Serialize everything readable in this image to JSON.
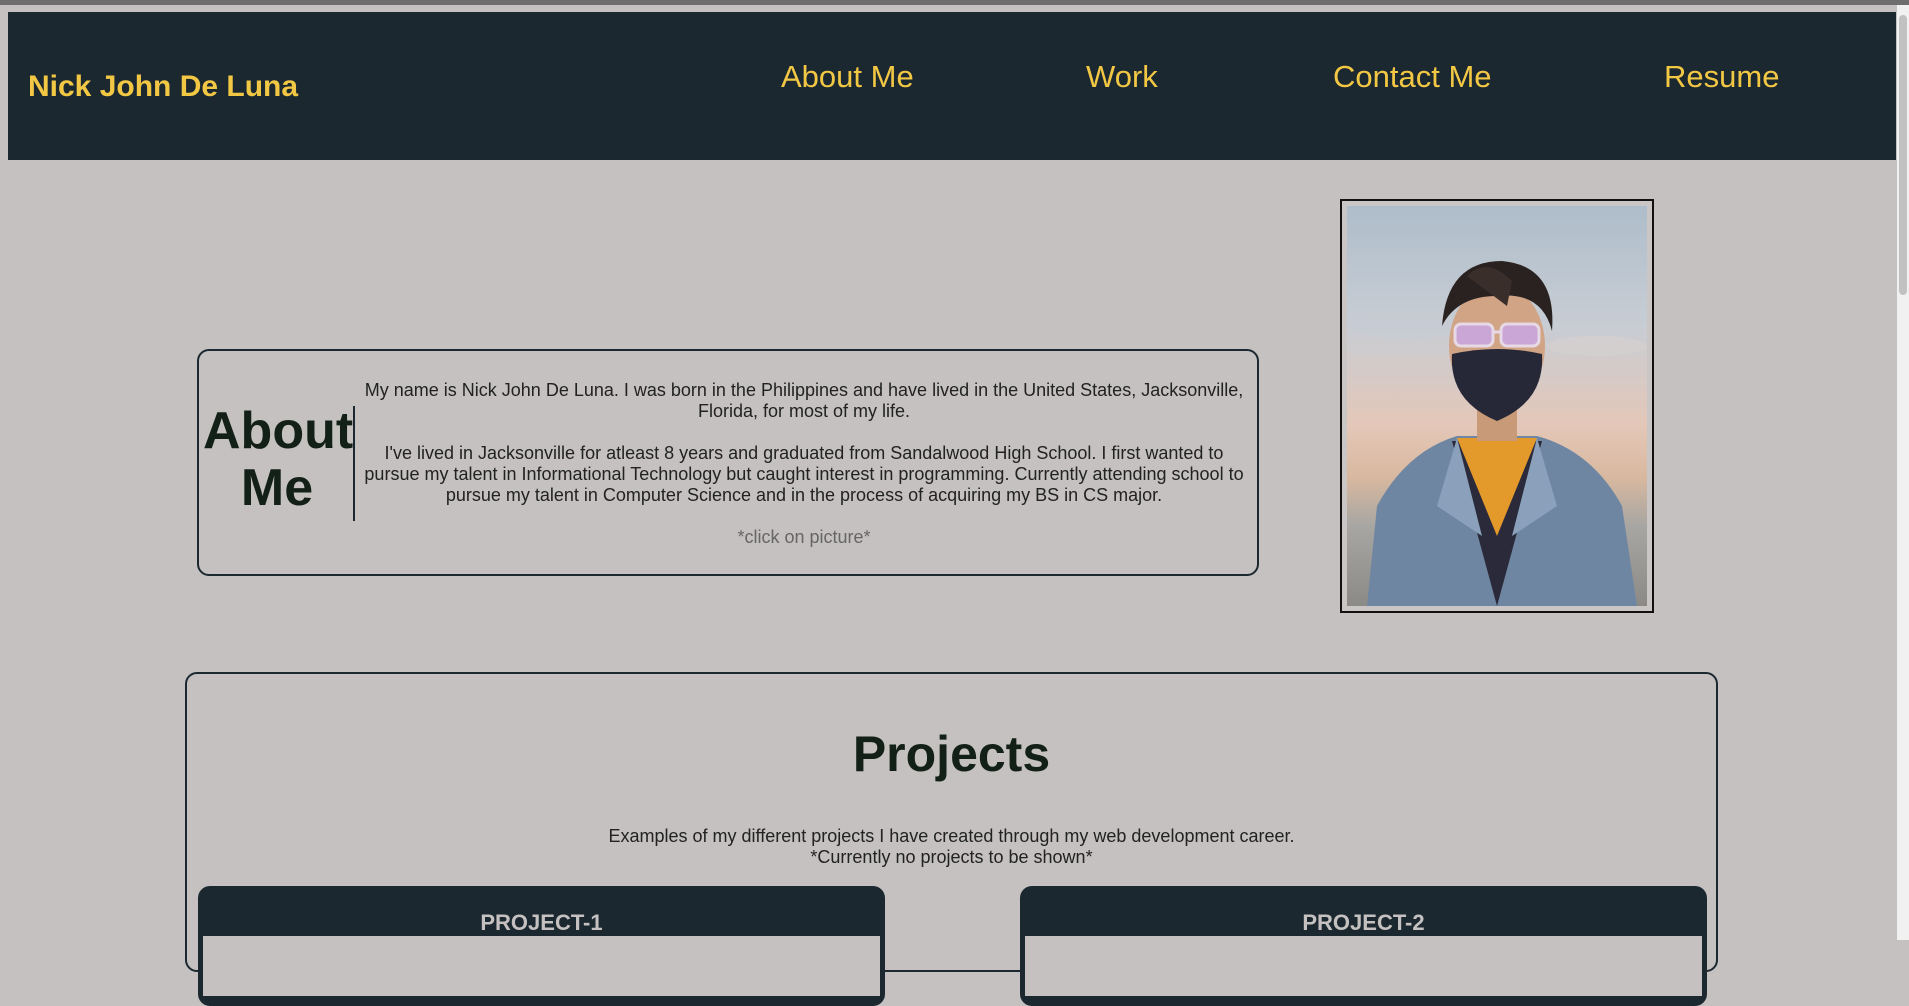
{
  "header": {
    "brand": "Nick John De Luna",
    "nav": [
      {
        "label": "About Me"
      },
      {
        "label": "Work"
      },
      {
        "label": "Contact Me"
      },
      {
        "label": "Resume"
      }
    ]
  },
  "about": {
    "title_line1": "About",
    "title_line2": "Me",
    "paragraph1": "My name is Nick John De Luna. I was born in the Philippines and have lived in the United States, Jacksonville, Florida, for most of my life.",
    "paragraph2": "I've lived in Jacksonville for atleast 8 years and graduated from Sandalwood High School. I first wanted to pursue my talent in Informational Technology but caught interest in programming. Currently attending school to pursue my talent in Computer Science and in the process of acquiring my BS in CS major.",
    "click_note": "*click on picture*"
  },
  "projects": {
    "title": "Projects",
    "desc_line1": "Examples of my different projects I have created through my web development career.",
    "desc_line2": "*Currently no projects to be shown*",
    "cards": [
      {
        "label": "PROJECT-1"
      },
      {
        "label": "PROJECT-2"
      }
    ]
  },
  "colors": {
    "accent": "#f2c744",
    "header_bg": "#1c2830",
    "page_bg": "#c4c1c0"
  }
}
